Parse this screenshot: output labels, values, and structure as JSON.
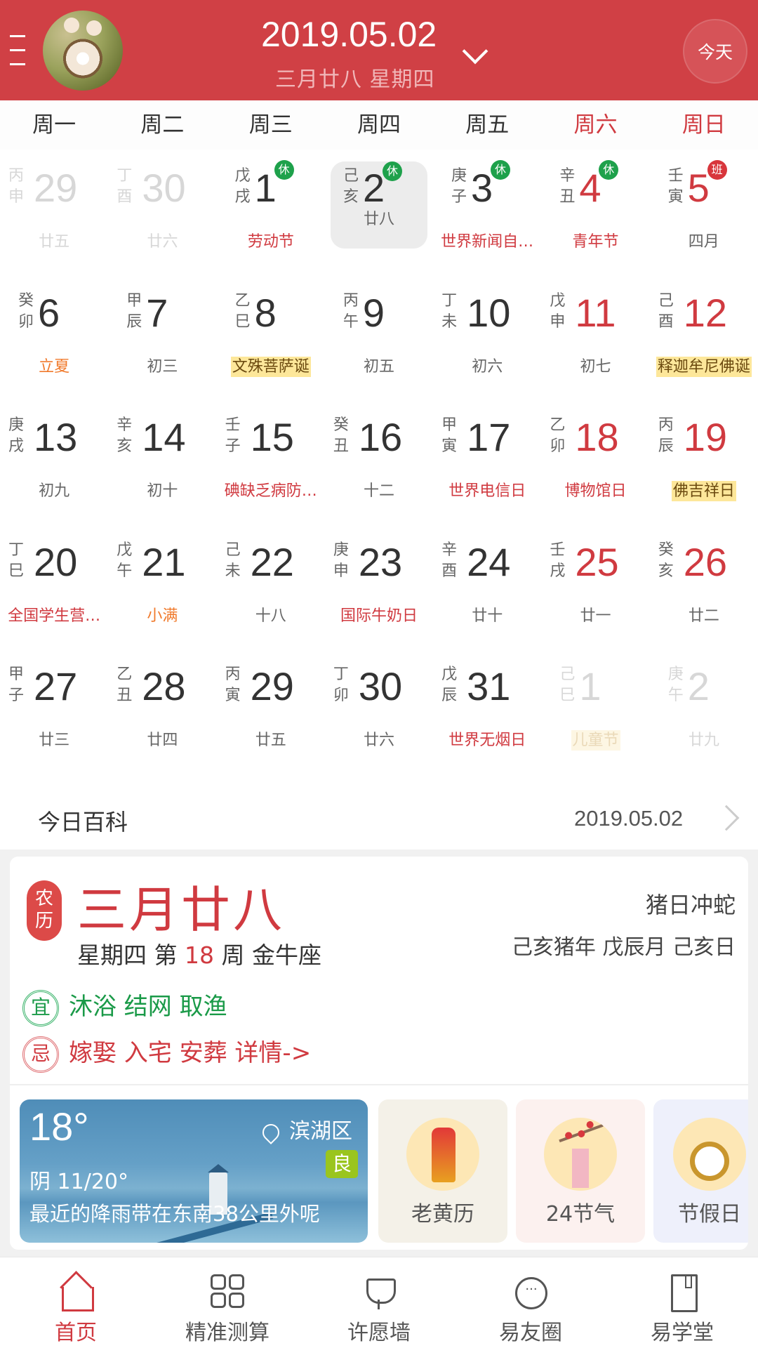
{
  "header": {
    "date": "2019.05.02",
    "lunar": "三月廿八 星期四",
    "today_label": "今天"
  },
  "weekdays": [
    {
      "label": "周一",
      "weekend": false
    },
    {
      "label": "周二",
      "weekend": false
    },
    {
      "label": "周三",
      "weekend": false
    },
    {
      "label": "周四",
      "weekend": false
    },
    {
      "label": "周五",
      "weekend": false
    },
    {
      "label": "周六",
      "weekend": true
    },
    {
      "label": "周日",
      "weekend": true
    }
  ],
  "calendar": [
    [
      {
        "gz": "丙申",
        "day": "29",
        "sub": "廿五",
        "dim": true
      },
      {
        "gz": "丁酉",
        "day": "30",
        "sub": "廿六",
        "dim": true
      },
      {
        "gz": "戊戌",
        "day": "1",
        "sub": "劳动节",
        "subStyle": "red",
        "badge": "休",
        "badgeType": "rest"
      },
      {
        "gz": "己亥",
        "day": "2",
        "sub": "廿八",
        "selected": true,
        "badge": "休",
        "badgeType": "rest"
      },
      {
        "gz": "庚子",
        "day": "3",
        "sub": "世界新闻自…",
        "subStyle": "red",
        "badge": "休",
        "badgeType": "rest"
      },
      {
        "gz": "辛丑",
        "day": "4",
        "sub": "青年节",
        "subStyle": "red",
        "red": true,
        "badge": "休",
        "badgeType": "rest"
      },
      {
        "gz": "壬寅",
        "day": "5",
        "sub": "四月",
        "red": true,
        "badge": "班",
        "badgeType": "work"
      }
    ],
    [
      {
        "gz": "癸卯",
        "day": "6",
        "sub": "立夏",
        "subStyle": "orange"
      },
      {
        "gz": "甲辰",
        "day": "7",
        "sub": "初三"
      },
      {
        "gz": "乙巳",
        "day": "8",
        "sub": "文殊菩萨诞",
        "subStyle": "hl"
      },
      {
        "gz": "丙午",
        "day": "9",
        "sub": "初五"
      },
      {
        "gz": "丁未",
        "day": "10",
        "sub": "初六"
      },
      {
        "gz": "戊申",
        "day": "11",
        "sub": "初七",
        "red": true
      },
      {
        "gz": "己酉",
        "day": "12",
        "sub": "释迦牟尼佛诞",
        "subStyle": "hl",
        "red": true
      }
    ],
    [
      {
        "gz": "庚戌",
        "day": "13",
        "sub": "初九"
      },
      {
        "gz": "辛亥",
        "day": "14",
        "sub": "初十"
      },
      {
        "gz": "壬子",
        "day": "15",
        "sub": "碘缺乏病防…",
        "subStyle": "red"
      },
      {
        "gz": "癸丑",
        "day": "16",
        "sub": "十二"
      },
      {
        "gz": "甲寅",
        "day": "17",
        "sub": "世界电信日",
        "subStyle": "red"
      },
      {
        "gz": "乙卯",
        "day": "18",
        "sub": "博物馆日",
        "subStyle": "red",
        "red": true
      },
      {
        "gz": "丙辰",
        "day": "19",
        "sub": "佛吉祥日",
        "subStyle": "hl",
        "red": true
      }
    ],
    [
      {
        "gz": "丁巳",
        "day": "20",
        "sub": "全国学生营…",
        "subStyle": "red"
      },
      {
        "gz": "戊午",
        "day": "21",
        "sub": "小满",
        "subStyle": "orange"
      },
      {
        "gz": "己未",
        "day": "22",
        "sub": "十八"
      },
      {
        "gz": "庚申",
        "day": "23",
        "sub": "国际牛奶日",
        "subStyle": "red"
      },
      {
        "gz": "辛酉",
        "day": "24",
        "sub": "廿十"
      },
      {
        "gz": "壬戌",
        "day": "25",
        "sub": "廿一",
        "red": true
      },
      {
        "gz": "癸亥",
        "day": "26",
        "sub": "廿二",
        "red": true
      }
    ],
    [
      {
        "gz": "甲子",
        "day": "27",
        "sub": "廿三"
      },
      {
        "gz": "乙丑",
        "day": "28",
        "sub": "廿四"
      },
      {
        "gz": "丙寅",
        "day": "29",
        "sub": "廿五"
      },
      {
        "gz": "丁卯",
        "day": "30",
        "sub": "廿六"
      },
      {
        "gz": "戊辰",
        "day": "31",
        "sub": "世界无烟日",
        "subStyle": "red"
      },
      {
        "gz": "己巳",
        "day": "1",
        "sub": "儿童节",
        "subStyle": "hl",
        "dim": true
      },
      {
        "gz": "庚午",
        "day": "2",
        "sub": "廿九",
        "dim": true
      }
    ]
  ],
  "baike": {
    "title": "今日百科",
    "date": "2019.05.02"
  },
  "almanac": {
    "badge": "农历",
    "lunar_date": "三月廿八",
    "weekday": "星期四",
    "week_prefix": "第",
    "week_num": "18",
    "week_suffix": "周",
    "zodiac_sign": "金牛座",
    "clash": "猪日冲蛇",
    "ganzhi": "己亥猪年 戊辰月 己亥日",
    "yi_seal": "宜",
    "yi": "沐浴 结网 取渔",
    "ji_seal": "忌",
    "ji": "嫁娶 入宅 安葬 详情->"
  },
  "weather": {
    "temp": "18°",
    "condition": "阴  11/20°",
    "message": "最近的降雨带在东南38公里外呢",
    "location": "滨湖区",
    "aqi": "良"
  },
  "tiles": [
    {
      "label": "老黄历"
    },
    {
      "label": "24节气"
    },
    {
      "label": "节假日"
    }
  ],
  "tabbar": [
    {
      "label": "首页",
      "icon": "home-icon",
      "active": true
    },
    {
      "label": "精准测算",
      "icon": "grid-icon"
    },
    {
      "label": "许愿墙",
      "icon": "tulip-icon"
    },
    {
      "label": "易友圈",
      "icon": "chat-icon"
    },
    {
      "label": "易学堂",
      "icon": "book-icon"
    }
  ],
  "colors": {
    "brand_red": "#d04045",
    "rest_green": "#1ea14b",
    "work_red": "#d8363c",
    "festival_highlight": "#fde79a"
  }
}
